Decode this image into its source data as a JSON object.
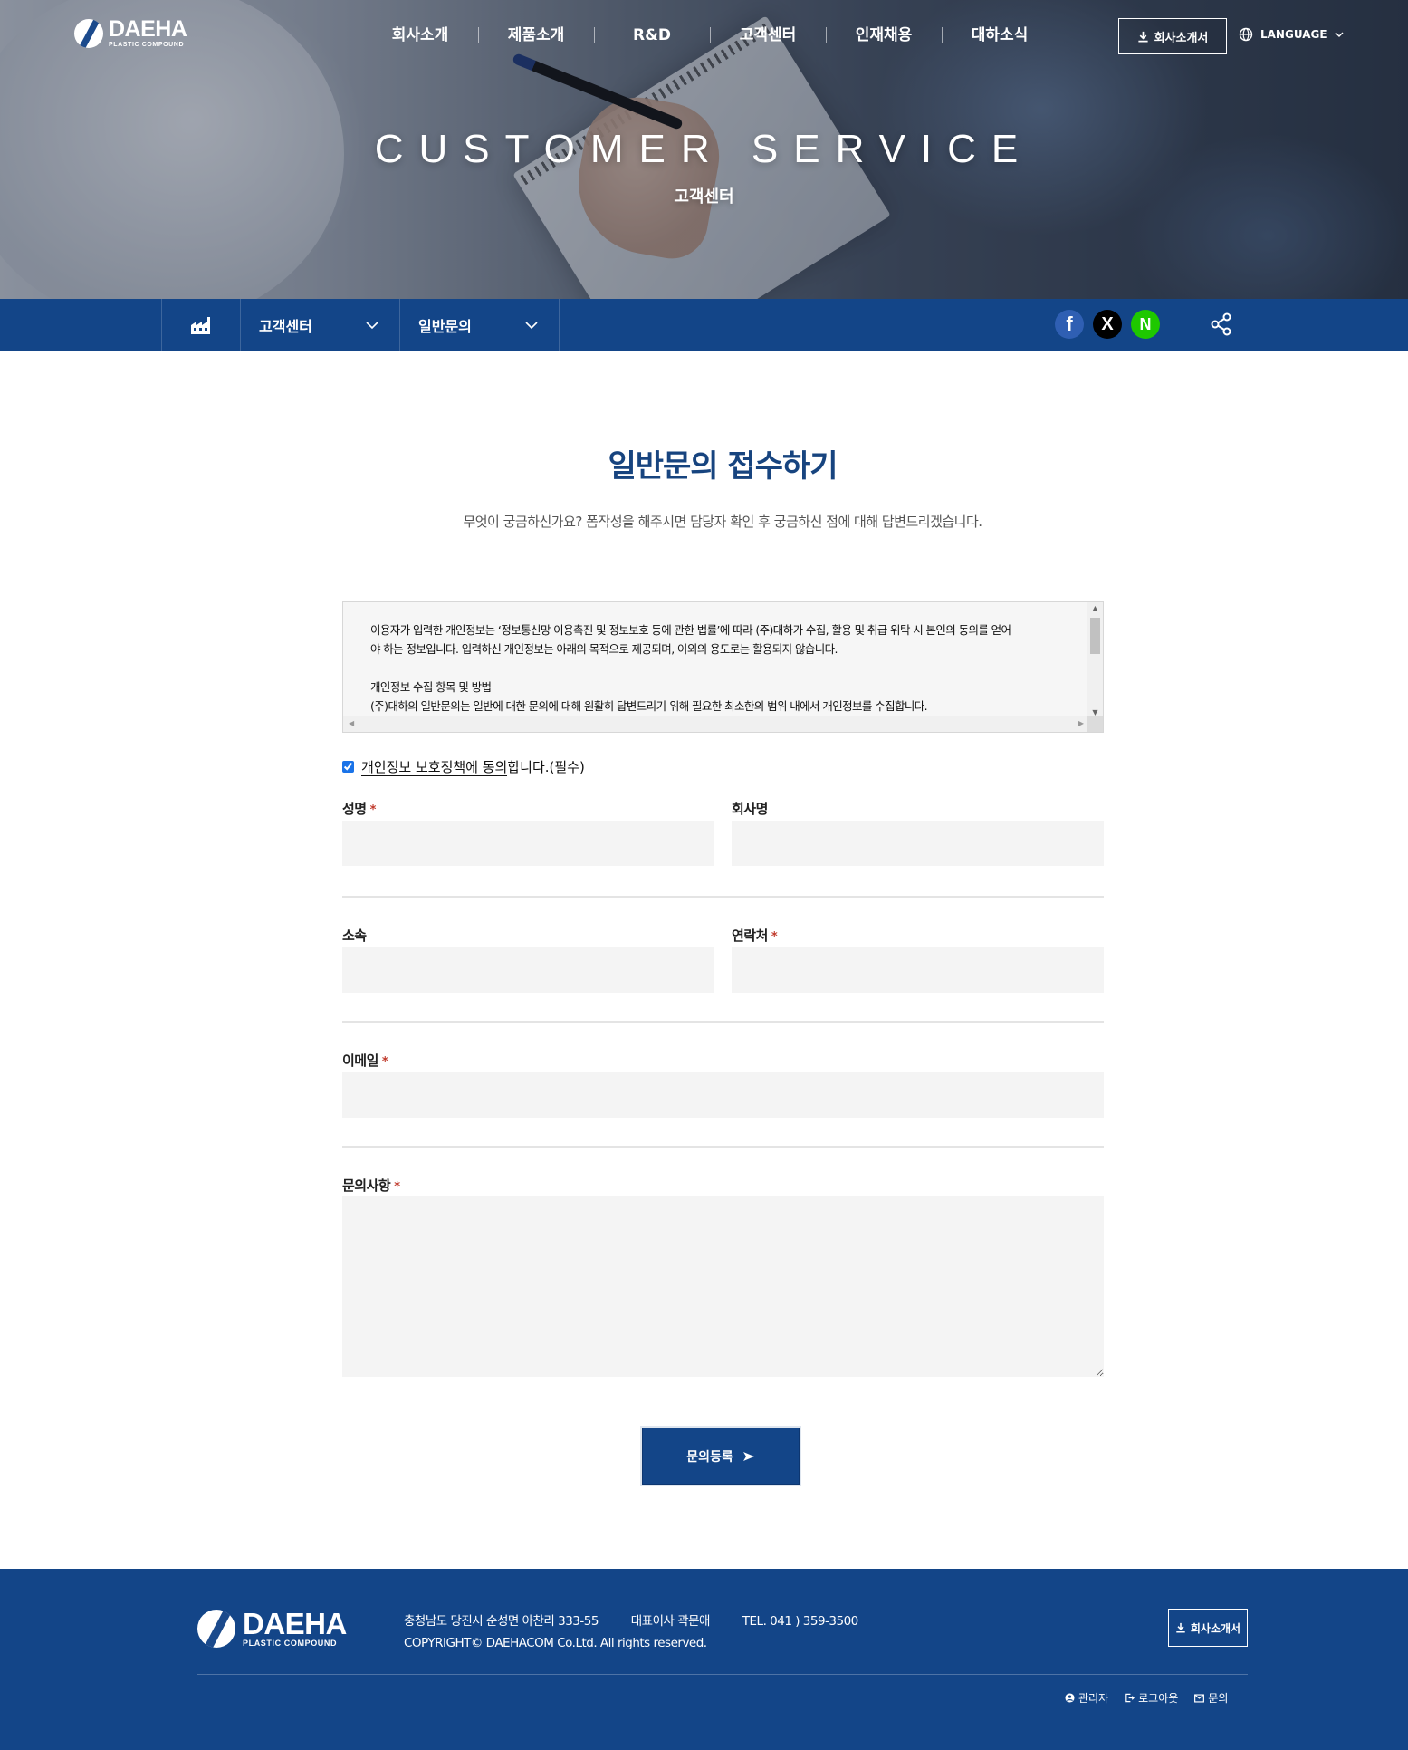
{
  "header": {
    "logo_main": "DAEHA",
    "logo_sub": "PLASTIC COMPOUND",
    "nav": [
      "회사소개",
      "제품소개",
      "R&D",
      "고객센터",
      "인재채용",
      "대하소식"
    ],
    "brochure_label": "회사소개서",
    "language_label": "LANGUAGE"
  },
  "hero": {
    "title": "CUSTOMER SERVICE",
    "subtitle": "고객센터"
  },
  "subnav": {
    "crumb1": "고객센터",
    "crumb2": "일반문의",
    "sns": {
      "facebook": "f",
      "x": "X",
      "naver": "N"
    },
    "colors": {
      "bar": "#134588",
      "facebook": "#2f5fb3",
      "naver": "#1ec800"
    }
  },
  "main": {
    "title": "일반문의 접수하기",
    "description": "무엇이 궁금하신가요? 폼작성을 해주시면 담당자 확인 후 궁금하신 점에 대해 답변드리겠습니다.",
    "terms": {
      "line1": "이용자가 입력한 개인정보는 ‘정보통신망 이용촉진 및 정보보호 등에 관한 법률’에 따라 (주)대하가 수집, 활용 및 취급 위탁 시 본인의 동의를 얻어",
      "line2": "야 하는 정보입니다. 입력하신 개인정보는 아래의 목적으로 제공되며, 이외의 용도로는 활용되지 않습니다.",
      "line3": "개인정보 수집 항목 및 방법",
      "line4": "(주)대하의 일반문의는 일반에 대한 문의에 대해 원활히 답변드리기 위해 필요한 최소한의 범위 내에서 개인정보를 수집합니다."
    },
    "agree_link": "개인정보 보호정책에 동의",
    "agree_rest": "합니다.(필수)",
    "required_mark": "*",
    "fields": {
      "name": "성명",
      "company": "회사명",
      "affiliation": "소속",
      "contact": "연락처",
      "email": "이메일",
      "inquiry": "문의사항"
    },
    "submit_label": "문의등록"
  },
  "footer": {
    "logo_main": "DAEHA",
    "logo_sub": "PLASTIC COMPOUND",
    "address": "충청남도 당진시 순성면 아찬리 333-55",
    "ceo": "대표이사 곽문애",
    "tel": "TEL. 041 ) 359-3500",
    "copyright": "COPYRIGHT© DAEHACOM Co.Ltd. All rights reserved.",
    "brochure_label": "회사소개서",
    "links": [
      "관리자",
      "로그아웃",
      "문의"
    ]
  }
}
